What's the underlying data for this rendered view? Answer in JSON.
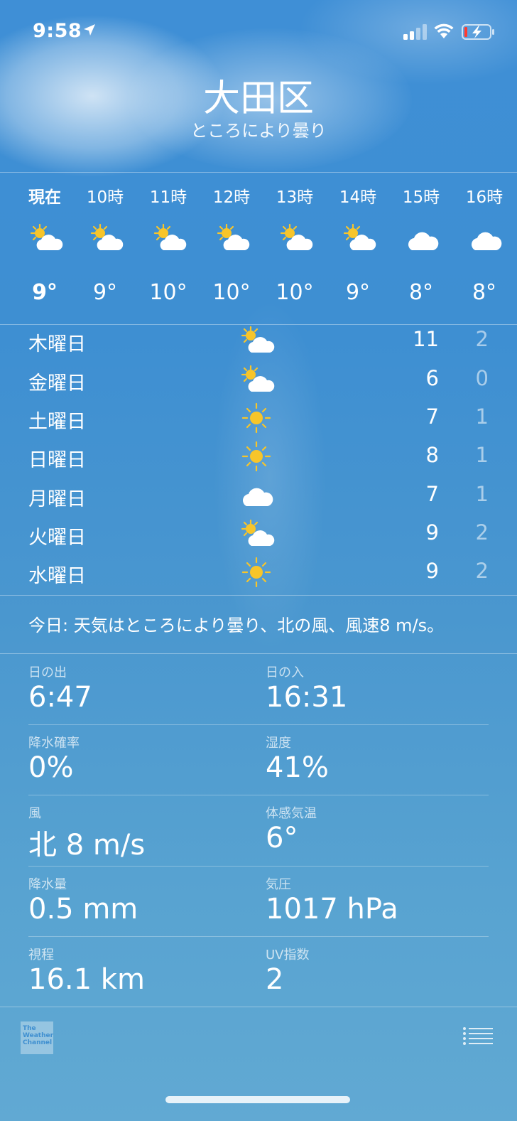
{
  "status_bar": {
    "time": "9:58",
    "icons": [
      "location-arrow-icon",
      "cellular-signal-icon",
      "wifi-icon",
      "battery-charging-icon"
    ]
  },
  "header": {
    "city": "大田区",
    "condition": "ところにより曇り"
  },
  "hourly": [
    {
      "label": "現在",
      "icon": "partly-cloudy-icon",
      "temp": "9°"
    },
    {
      "label": "10時",
      "icon": "partly-cloudy-icon",
      "temp": "9°"
    },
    {
      "label": "11時",
      "icon": "partly-cloudy-icon",
      "temp": "10°"
    },
    {
      "label": "12時",
      "icon": "partly-cloudy-icon",
      "temp": "10°"
    },
    {
      "label": "13時",
      "icon": "partly-cloudy-icon",
      "temp": "10°"
    },
    {
      "label": "14時",
      "icon": "partly-cloudy-icon",
      "temp": "9°"
    },
    {
      "label": "15時",
      "icon": "cloud-icon",
      "temp": "8°"
    },
    {
      "label": "16時",
      "icon": "cloud-icon",
      "temp": "8°"
    }
  ],
  "daily": [
    {
      "day": "木曜日",
      "icon": "partly-cloudy-icon",
      "high": "11",
      "low": "2"
    },
    {
      "day": "金曜日",
      "icon": "partly-cloudy-icon",
      "high": "6",
      "low": "0"
    },
    {
      "day": "土曜日",
      "icon": "sun-icon",
      "high": "7",
      "low": "1"
    },
    {
      "day": "日曜日",
      "icon": "sun-icon",
      "high": "8",
      "low": "1"
    },
    {
      "day": "月曜日",
      "icon": "cloud-icon",
      "high": "7",
      "low": "1"
    },
    {
      "day": "火曜日",
      "icon": "partly-cloudy-icon",
      "high": "9",
      "low": "2"
    },
    {
      "day": "水曜日",
      "icon": "sun-icon",
      "high": "9",
      "low": "2"
    }
  ],
  "summary": "今日: 天気はところにより曇り、北の風、風速8 m/s。",
  "details": [
    [
      {
        "label": "日の出",
        "value": "6:47"
      },
      {
        "label": "日の入",
        "value": "16:31"
      }
    ],
    [
      {
        "label": "降水確率",
        "value": "0%"
      },
      {
        "label": "湿度",
        "value": "41%"
      }
    ],
    [
      {
        "label": "風",
        "value": "北 8 m/s"
      },
      {
        "label": "体感気温",
        "value": "6°"
      }
    ],
    [
      {
        "label": "降水量",
        "value": "0.5 mm"
      },
      {
        "label": "気圧",
        "value": "1017 hPa"
      }
    ],
    [
      {
        "label": "視程",
        "value": "16.1 km"
      },
      {
        "label": "UV指数",
        "value": "2"
      }
    ]
  ],
  "footer": {
    "logo_lines": [
      "The",
      "Weather",
      "Channel"
    ],
    "list_icon": "list-icon"
  },
  "colors": {
    "background_top": "#3f8fd6",
    "background_bottom": "#61a9d3",
    "sun": "#f7c52a",
    "cloud": "#ffffff"
  }
}
